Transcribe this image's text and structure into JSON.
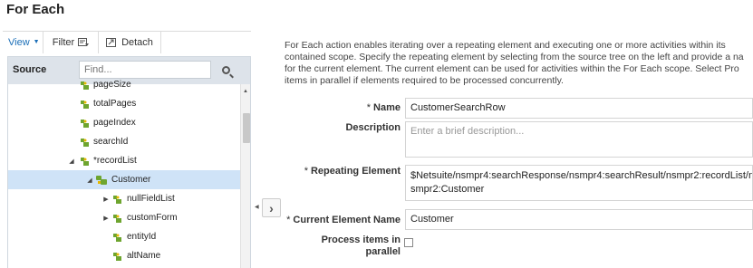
{
  "page": {
    "title": "For Each"
  },
  "toolbar": {
    "view_label": "View",
    "filter_label": "Filter",
    "detach_label": "Detach"
  },
  "source": {
    "label": "Source",
    "find_placeholder": "Find...",
    "tree": [
      {
        "label": "pageSize",
        "expander": "",
        "icon": "element-icon"
      },
      {
        "label": "totalPages",
        "expander": "",
        "icon": "element-icon"
      },
      {
        "label": "pageIndex",
        "expander": "",
        "icon": "element-icon"
      },
      {
        "label": "searchId",
        "expander": "",
        "icon": "element-icon"
      },
      {
        "label": "*recordList",
        "expander": "expanded",
        "icon": "element-icon"
      },
      {
        "label": "Customer",
        "expander": "expanded",
        "icon": "repeating-element-icon",
        "selected": true
      },
      {
        "label": "nullFieldList",
        "expander": "collapsed",
        "icon": "element-icon"
      },
      {
        "label": "customForm",
        "expander": "collapsed",
        "icon": "element-icon"
      },
      {
        "label": "entityId",
        "expander": "",
        "icon": "element-icon"
      },
      {
        "label": "altName",
        "expander": "",
        "icon": "element-icon"
      }
    ]
  },
  "description": {
    "lines": [
      "For Each action enables iterating over a repeating element and executing one or more activities within its",
      "contained scope. Specify the repeating element by selecting from the source tree on the left and provide a na",
      "for the current element. The current element can be used for activities within the For Each scope. Select Pro",
      "items in parallel if elements required to be processed concurrently."
    ]
  },
  "form": {
    "name_label": "Name",
    "name_value": "CustomerSearchRow",
    "description_label": "Description",
    "description_placeholder": "Enter a brief description...",
    "repeating_label": "Repeating Element",
    "repeating_value": "$Netsuite/nsmpr4:searchResponse/nsmpr4:searchResult/nsmpr2:recordList/n\nsmpr2:Customer",
    "current_label": "Current Element Name",
    "current_value": "Customer",
    "parallel_label_line1": "Process items in",
    "parallel_label_line2": "parallel",
    "required_marker": "*",
    "parallel_checked": false
  },
  "colors": {
    "accent": "#1c6fb8",
    "header_bg": "#dde3ea",
    "selected_row": "#cfe3f7",
    "node_green": "#6ea52f",
    "node_yellow": "#e6b800"
  }
}
